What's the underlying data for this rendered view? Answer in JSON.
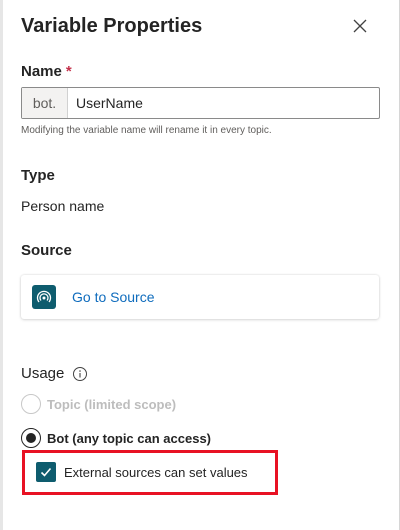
{
  "panel": {
    "title": "Variable Properties",
    "close_icon": "close-icon"
  },
  "name_section": {
    "label": "Name",
    "required_marker": "*",
    "prefix": "bot.",
    "value": "UserName",
    "helper": "Modifying the variable name will rename it in every topic."
  },
  "type_section": {
    "label": "Type",
    "value": "Person name"
  },
  "source_section": {
    "label": "Source",
    "link_label": "Go to Source",
    "icon": "broadcast-icon"
  },
  "usage_section": {
    "label": "Usage",
    "info_icon": "info-icon",
    "options": [
      {
        "label": "Topic (limited scope)",
        "selected": false,
        "disabled": true
      },
      {
        "label": "Bot (any topic can access)",
        "selected": true,
        "disabled": false
      }
    ],
    "external": {
      "label": "External sources can set values",
      "checked": true
    }
  },
  "colors": {
    "accent": "#0e5c6e",
    "link": "#0f6cbd",
    "required": "#c4314b",
    "highlight": "#e81123"
  }
}
